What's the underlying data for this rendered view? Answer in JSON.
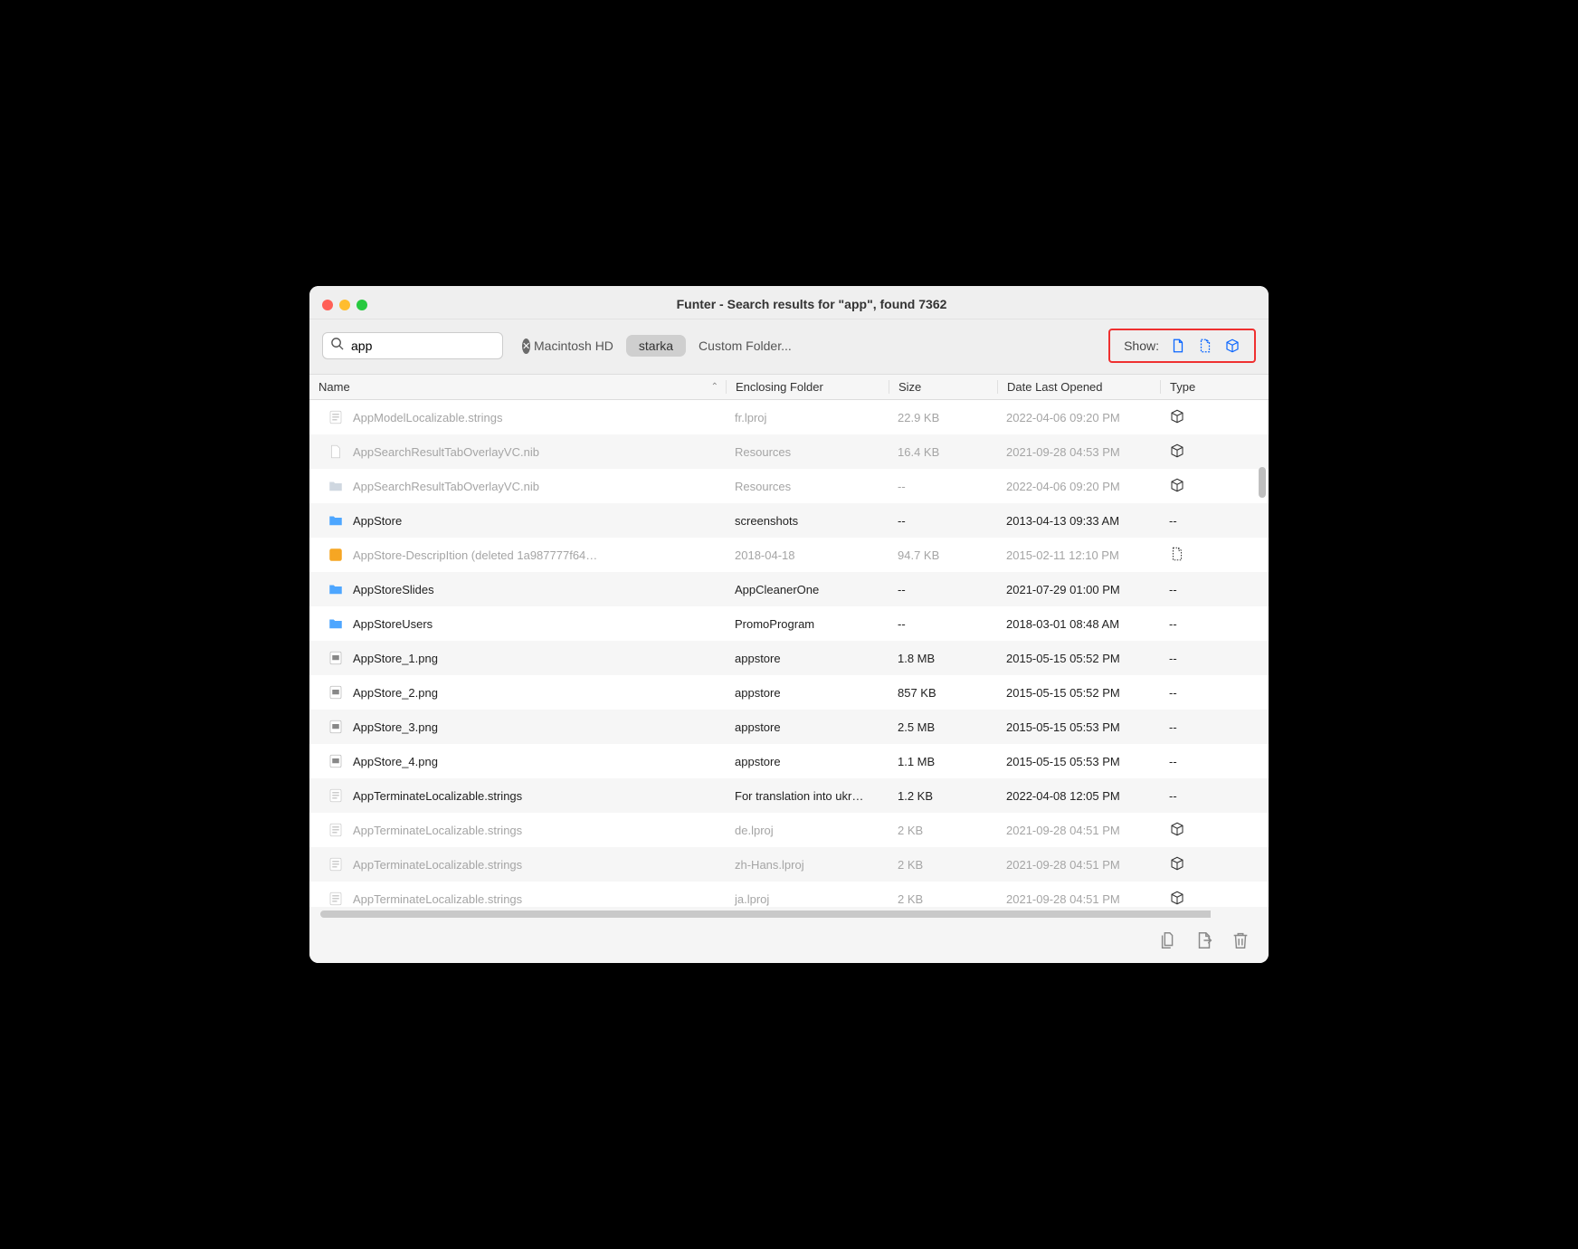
{
  "title": "Funter - Search results for \"app\", found 7362",
  "search": {
    "value": "app"
  },
  "locations": [
    {
      "label": "Macintosh HD",
      "active": false
    },
    {
      "label": "starka",
      "active": true
    },
    {
      "label": "Custom Folder...",
      "active": false
    }
  ],
  "show": {
    "label": "Show:"
  },
  "columns": {
    "name": "Name",
    "folder": "Enclosing Folder",
    "size": "Size",
    "date": "Date Last Opened",
    "type": "Type"
  },
  "rows": [
    {
      "name": "AppModelLocalizable.strings",
      "folder": "fr.lproj",
      "size": "22.9 KB",
      "date": "2022-04-06 09:20 PM",
      "type": "package",
      "icon": "strings",
      "dim": true
    },
    {
      "name": "AppSearchResultTabOverlayVC.nib",
      "folder": "Resources",
      "size": "16.4 KB",
      "date": "2021-09-28 04:53 PM",
      "type": "package",
      "icon": "blank",
      "dim": true
    },
    {
      "name": "AppSearchResultTabOverlayVC.nib",
      "folder": "Resources",
      "size": "--",
      "date": "2022-04-06 09:20 PM",
      "type": "package",
      "icon": "folder",
      "dim": true
    },
    {
      "name": "AppStore",
      "folder": "screenshots",
      "size": "--",
      "date": "2013-04-13 09:33 AM",
      "type": "--",
      "icon": "folder",
      "dim": false
    },
    {
      "name": "AppStore-DescripItion (deleted 1a987777f64…",
      "folder": "2018-04-18",
      "size": "94.7 KB",
      "date": "2015-02-11 12:10 PM",
      "type": "hidden",
      "icon": "orange",
      "dim": true
    },
    {
      "name": "AppStoreSlides",
      "folder": "AppCleanerOne",
      "size": "--",
      "date": "2021-07-29 01:00 PM",
      "type": "--",
      "icon": "folder",
      "dim": false
    },
    {
      "name": "AppStoreUsers",
      "folder": "PromoProgram",
      "size": "--",
      "date": "2018-03-01 08:48 AM",
      "type": "--",
      "icon": "folder",
      "dim": false
    },
    {
      "name": "AppStore_1.png",
      "folder": "appstore",
      "size": "1.8 MB",
      "date": "2015-05-15 05:52 PM",
      "type": "--",
      "icon": "png",
      "dim": false
    },
    {
      "name": "AppStore_2.png",
      "folder": "appstore",
      "size": "857 KB",
      "date": "2015-05-15 05:52 PM",
      "type": "--",
      "icon": "png",
      "dim": false
    },
    {
      "name": "AppStore_3.png",
      "folder": "appstore",
      "size": "2.5 MB",
      "date": "2015-05-15 05:53 PM",
      "type": "--",
      "icon": "png",
      "dim": false
    },
    {
      "name": "AppStore_4.png",
      "folder": "appstore",
      "size": "1.1 MB",
      "date": "2015-05-15 05:53 PM",
      "type": "--",
      "icon": "png",
      "dim": false
    },
    {
      "name": "AppTerminateLocalizable.strings",
      "folder": "For translation into ukr…",
      "size": "1.2 KB",
      "date": "2022-04-08 12:05 PM",
      "type": "--",
      "icon": "strings",
      "dim": false
    },
    {
      "name": "AppTerminateLocalizable.strings",
      "folder": "de.lproj",
      "size": "2 KB",
      "date": "2021-09-28 04:51 PM",
      "type": "package",
      "icon": "strings",
      "dim": true
    },
    {
      "name": "AppTerminateLocalizable.strings",
      "folder": "zh-Hans.lproj",
      "size": "2 KB",
      "date": "2021-09-28 04:51 PM",
      "type": "package",
      "icon": "strings",
      "dim": true
    },
    {
      "name": "AppTerminateLocalizable.strings",
      "folder": "ja.lproj",
      "size": "2 KB",
      "date": "2021-09-28 04:51 PM",
      "type": "package",
      "icon": "strings",
      "dim": true
    }
  ]
}
